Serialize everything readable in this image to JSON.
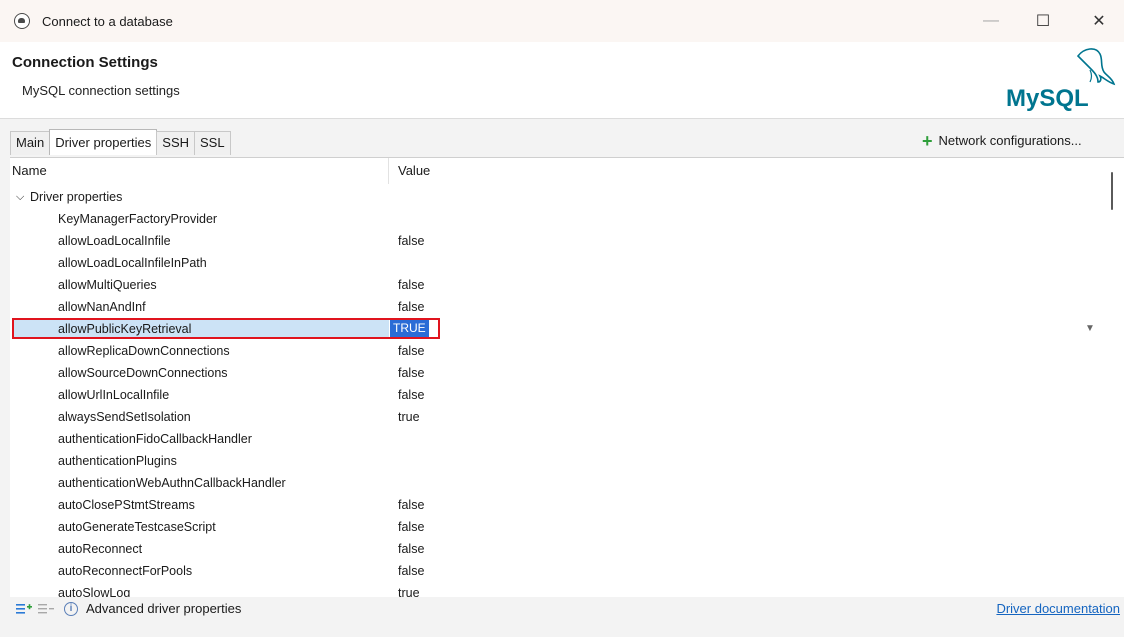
{
  "window": {
    "title": "Connect to a database",
    "controls": {
      "minimize": "—",
      "maximize": "☐",
      "close": "✕"
    }
  },
  "header": {
    "title": "Connection Settings",
    "subtitle": "MySQL connection settings",
    "logo_text": "MySQL"
  },
  "tabs": [
    {
      "label": "Main",
      "active": false
    },
    {
      "label": "Driver properties",
      "active": true
    },
    {
      "label": "SSH",
      "active": false
    },
    {
      "label": "SSL",
      "active": false
    }
  ],
  "network_config": {
    "label": "Network configurations..."
  },
  "table": {
    "columns": {
      "name": "Name",
      "value": "Value"
    },
    "group": {
      "label": "Driver properties",
      "chevron": "⌄"
    },
    "rows": [
      {
        "name": "KeyManagerFactoryProvider",
        "value": ""
      },
      {
        "name": "allowLoadLocalInfile",
        "value": "false"
      },
      {
        "name": "allowLoadLocalInfileInPath",
        "value": ""
      },
      {
        "name": "allowMultiQueries",
        "value": "false"
      },
      {
        "name": "allowNanAndInf",
        "value": "false"
      },
      {
        "name": "allowPublicKeyRetrieval",
        "value": "TRUE"
      },
      {
        "name": "allowReplicaDownConnections",
        "value": "false"
      },
      {
        "name": "allowSourceDownConnections",
        "value": "false"
      },
      {
        "name": "allowUrlInLocalInfile",
        "value": "false"
      },
      {
        "name": "alwaysSendSetIsolation",
        "value": "true"
      },
      {
        "name": "authenticationFidoCallbackHandler",
        "value": ""
      },
      {
        "name": "authenticationPlugins",
        "value": ""
      },
      {
        "name": "authenticationWebAuthnCallbackHandler",
        "value": ""
      },
      {
        "name": "autoClosePStmtStreams",
        "value": "false"
      },
      {
        "name": "autoGenerateTestcaseScript",
        "value": "false"
      },
      {
        "name": "autoReconnect",
        "value": "false"
      },
      {
        "name": "autoReconnectForPools",
        "value": "false"
      },
      {
        "name": "autoSlowLog",
        "value": "true"
      }
    ],
    "selected_index": 5,
    "dropdown_glyph": "▼"
  },
  "bottom": {
    "info_glyph": "i",
    "advanced_label": "Advanced driver properties",
    "doc_link": "Driver documentation"
  },
  "colors": {
    "accent": "#2a6cd6",
    "highlight_border": "#e0141e",
    "add_green": "#2e9e3a",
    "link": "#1565c0"
  }
}
